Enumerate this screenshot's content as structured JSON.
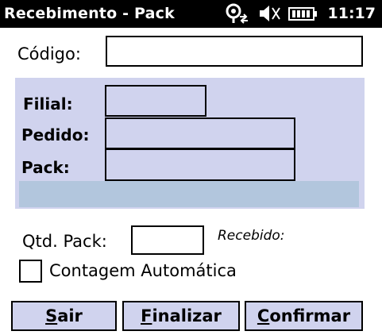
{
  "titlebar": {
    "title": "Recebimento - Pack",
    "time": "11:17",
    "icons": [
      "connectivity-icon",
      "volume-muted-icon",
      "battery-icon"
    ]
  },
  "form": {
    "codigo_label": "Código:",
    "codigo_value": "",
    "filial_label": "Filial:",
    "filial_value": "",
    "pedido_label": "Pedido:",
    "pedido_value": "",
    "pack_label": "Pack:",
    "pack_value": "",
    "qtd_pack_label": "Qtd. Pack:",
    "qtd_pack_value": "",
    "recebido_label": "Recebido:",
    "contagem_label": "Contagem Automática",
    "contagem_checked": false
  },
  "buttons": {
    "sair": {
      "accel": "S",
      "rest": "air"
    },
    "finalizar": {
      "accel": "F",
      "rest": "inalizar"
    },
    "confirmar": {
      "accel": "C",
      "rest": "onfirmar"
    }
  },
  "colors": {
    "titlebar": "#000000",
    "panel": "#d0d3ee",
    "status_strip": "#b2c6dd",
    "button": "#d0d3ee"
  }
}
